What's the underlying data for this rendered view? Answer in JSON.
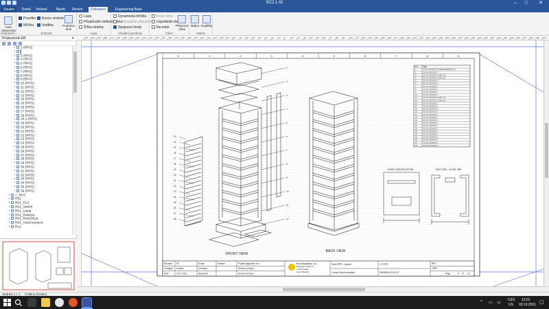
{
  "titlebar": {
    "title": "SC2.1.42"
  },
  "tabs": [
    {
      "label": "Soubor",
      "state": "file"
    },
    {
      "label": "Domů",
      "state": ""
    },
    {
      "label": "Vložení",
      "state": ""
    },
    {
      "label": "Návrh",
      "state": ""
    },
    {
      "label": "Revize",
      "state": ""
    },
    {
      "label": "Zobrazení",
      "state": "active"
    },
    {
      "label": "Engineering Base",
      "state": ""
    }
  ],
  "ribbon": {
    "groups": {
      "zobrazeni": "Zobrazení",
      "zobrazit": "Zobrazit",
      "lupa": "Lupa",
      "pomucky": "Vizuální pomůcky",
      "okno": "Okno",
      "makra": "Makra"
    },
    "btn_celaobrazovka": "Celá obrazovka",
    "chk_pravitko": "Pravítko",
    "chk_mrizka": "Mřížka",
    "chk_konce": "Konce stránek",
    "chk_voditka": "Vodítka",
    "btn_podokna": "Podokna úloh",
    "btn_lupa": "Lupa",
    "btn_prizpusobit": "Přizpůsobit velikosti okna",
    "btn_sirka": "Šířka stránky",
    "chk_dynmrizka": "Dynamická mřížka",
    "chk_autopripojeni": "Automatické připojení",
    "chk_spojovaci": "Spojovací body",
    "btn_nove_okno": "Nové okno",
    "btn_usporadat": "Uspořádat vše",
    "btn_kaskadou": "Na sebe",
    "btn_prepnout": "Přepnout okna",
    "btn_makra": "Makra",
    "btn_doplnky": "Doplňky"
  },
  "leftpanel": {
    "title": "Průzkumník EB",
    "tree": [
      {
        "label": "1 (RPS)",
        "sel": false,
        "indent": 1
      },
      {
        "label": "",
        "sel": true,
        "indent": 1
      },
      {
        "label": "3 (RPS)",
        "sel": false,
        "indent": 1
      },
      {
        "label": "4 (RPS)",
        "sel": false,
        "indent": 1
      },
      {
        "label": "5 (RPS)",
        "sel": false,
        "indent": 1
      },
      {
        "label": "6 (RPS)",
        "sel": false,
        "indent": 1
      },
      {
        "label": "7 (RPS)",
        "sel": false,
        "indent": 1
      },
      {
        "label": "8 (RPS)",
        "sel": false,
        "indent": 1
      },
      {
        "label": "9 (RPS)",
        "sel": false,
        "indent": 1
      },
      {
        "label": "10 (RPS)",
        "sel": false,
        "indent": 1
      },
      {
        "label": "11 (RPS)",
        "sel": false,
        "indent": 1
      },
      {
        "label": "12 (RPS)",
        "sel": false,
        "indent": 1
      },
      {
        "label": "13 (RPS)",
        "sel": false,
        "indent": 1
      },
      {
        "label": "14 (RPS)",
        "sel": false,
        "indent": 1
      },
      {
        "label": "15 (RPS)",
        "sel": false,
        "indent": 1
      },
      {
        "label": "16 (RPS)",
        "sel": false,
        "indent": 1
      },
      {
        "label": "17 (RPS)",
        "sel": false,
        "indent": 1
      },
      {
        "label": "18 (RPS)",
        "sel": false,
        "indent": 1
      },
      {
        "label": "18.1 (RPS)",
        "sel": false,
        "indent": 1
      },
      {
        "label": "19 (RPS)",
        "sel": false,
        "indent": 1
      },
      {
        "label": "20 (RPS)",
        "sel": false,
        "indent": 1
      },
      {
        "label": "21 (RPS)",
        "sel": false,
        "indent": 1
      },
      {
        "label": "22 (RPS)",
        "sel": false,
        "indent": 1
      },
      {
        "label": "23 (RPS)",
        "sel": false,
        "indent": 1
      },
      {
        "label": "24 (RPS)",
        "sel": false,
        "indent": 1
      },
      {
        "label": "25 (RPS)",
        "sel": false,
        "indent": 1
      },
      {
        "label": "26 (RPS)",
        "sel": false,
        "indent": 1
      },
      {
        "label": "27 (RPS)",
        "sel": false,
        "indent": 1
      },
      {
        "label": "28 (RPS)",
        "sel": false,
        "indent": 1
      },
      {
        "label": "29 (RPS)",
        "sel": false,
        "indent": 1
      },
      {
        "label": "30 (RPS)",
        "sel": false,
        "indent": 1
      },
      {
        "label": "31 (RPS)",
        "sel": false,
        "indent": 1
      },
      {
        "label": "32 (RPS)",
        "sel": false,
        "indent": 1
      },
      {
        "label": "33 (RPS)",
        "sel": false,
        "indent": 1
      },
      {
        "label": "34 (RPS)",
        "sel": false,
        "indent": 1
      },
      {
        "label": "35 (RPS)",
        "sel": false,
        "indent": 1
      },
      {
        "label": "36 (RPS)",
        "sel": false,
        "indent": 1
      },
      {
        "label": "+_RCC",
        "sel": false,
        "indent": 0
      },
      {
        "label": "R01",
        "sel": false,
        "indent": 0
      },
      {
        "label": "R01_PLC",
        "sel": false,
        "indent": 0
      },
      {
        "label": "R01_Switch",
        "sel": false,
        "indent": 0
      },
      {
        "label": "R01_Lamp",
        "sel": false,
        "indent": 0
      },
      {
        "label": "R01_Rulesys",
        "sel": false,
        "indent": 0
      },
      {
        "label": "R01_RuleSrDut",
        "sel": false,
        "indent": 0
      },
      {
        "label": "R01_AutoCounters",
        "sel": false,
        "indent": 0
      },
      {
        "label": "RLs",
        "sel": false,
        "indent": 0
      }
    ]
  },
  "ruler": {
    "ticks": [
      "310",
      "300",
      "290",
      "280",
      "270",
      "260",
      "250",
      "240",
      "230",
      "220",
      "210",
      "200",
      "190",
      "180",
      "170",
      "160",
      "150",
      "140",
      "130",
      "120",
      "110",
      "100",
      "90",
      "80",
      "70",
      "60",
      "50",
      "40",
      "30",
      "20",
      "10",
      "0",
      "10",
      "20",
      "30",
      "40",
      "50",
      "60",
      "70",
      "80",
      "90",
      "100",
      "110",
      "120",
      "130",
      "140",
      "150",
      "160",
      "170",
      "180",
      "190",
      "200",
      "210",
      "220",
      "230",
      "240",
      "250",
      "260",
      "270",
      "280",
      "290",
      "300",
      "310",
      "320",
      "330",
      "340",
      "350",
      "360",
      "370",
      "380",
      "390",
      "400"
    ]
  },
  "drawing": {
    "border_cols": [
      "0",
      "1",
      "2",
      "3",
      "4",
      "5",
      "6",
      "7",
      "8",
      "9"
    ],
    "front_view": "FRONT VIEW",
    "back_view": "BACK VIEW",
    "roof_modification": "ROOF MODIFICATION",
    "section_level": "SECTION - LEVEL 380",
    "callouts_left": [
      "13",
      "14",
      "15",
      "16",
      "17",
      "18",
      "19",
      "20",
      "21",
      "22",
      "23",
      "24",
      "25",
      "26",
      "27",
      "28"
    ],
    "callouts_right": [
      "1",
      "2",
      "3",
      "4",
      "5",
      "6",
      "7",
      "8",
      "9",
      "10",
      "11",
      "12"
    ],
    "parts_table": {
      "headers": [
        "Pos.",
        "Type"
      ],
      "rows": [
        [
          "1",
          "XX.XX.XXXXXX.X (1000x1000x800 mm)"
        ],
        [
          "2",
          "XX.XX.XXXXXX.X"
        ],
        [
          "3",
          "XX.XX.XXXXXX.X (150 mm)"
        ],
        [
          "4",
          "XX.XX.XXXXXX.X (100 mm)"
        ],
        [
          "5",
          "XX.XX.XXXXXX.X"
        ],
        [
          "6",
          "XX.XX.XXXXXX.X"
        ],
        [
          "7",
          "XX.XX.XXXXXX.X"
        ],
        [
          "8",
          "XX.XX.XXXXXX.X"
        ],
        [
          "9",
          "XX.XX.XXXXXX.X"
        ],
        [
          "10",
          "XX.XX.XXXXXX.X"
        ],
        [
          "11",
          "XX.XX.XXXXXX.X (100 mm)"
        ],
        [
          "12",
          "XX.XX.XXXXXX.X (150 mm)"
        ],
        [
          "13",
          "XX.XX.XXXXXX.X"
        ],
        [
          "14",
          "XX.XX.XXXXXX.X"
        ],
        [
          "15",
          "XX.XX.XXXXXX.X"
        ],
        [
          "16",
          "XX.XX.XXXXXX.X"
        ],
        [
          "17",
          "XX.XX.XXXXXX.X"
        ],
        [
          "18",
          "XX.XX.XXXXXX.X"
        ],
        [
          "19",
          "XX.XX.XXXXXX.X"
        ],
        [
          "20",
          "XX.XX.XXXXXX.X"
        ],
        [
          "21",
          "XX.XX.XXXXXX.X"
        ],
        [
          "22",
          "XX.XX.XXXXXX.X"
        ],
        [
          "23",
          "XX.XX.XXXXXX.X"
        ],
        [
          "24",
          "XX.XX.XXXXXX.X"
        ],
        [
          "25",
          "XX.XX.XXXXXX.X"
        ],
        [
          "26",
          "XX.XX.XXXXXX.X"
        ],
        [
          "27",
          "XX.XX.XXXXXX.X"
        ],
        [
          "28",
          "XX.XX.XXXXXX.X"
        ]
      ]
    },
    "titleblock": {
      "revision_label": "Revision",
      "revision_val": "00",
      "changed_label": "Changed",
      "changed_val": "Kostlan",
      "date_label": "Date",
      "date_val": "12.07.2021",
      "drawn_label": "Drawn",
      "drawn_val": "Kostlan",
      "checked_label": "Checked",
      "checked_val": "",
      "approved_label": "Approved",
      "approved_val": "",
      "project_l1": "Projekt Signalizer, a.s.",
      "project_l2": "Servisní pohyon",
      "project_l3": "Servisní pohyon",
      "company_l1": "Prosa Signalizer, a.s.",
      "company_l2": "Bohuslavova 368 / 12",
      "company_l3": "712 00 Ostrava",
      "company_l4": "Czech Republic",
      "desc_l1": "Rack RPS - Layout",
      "desc_l2": "Control Rack standard",
      "docnum": "59000669-SCH-01",
      "plant": "+C RPS",
      "loc1": "RPS",
      "loc2": "+RPS",
      "page_label": "Page",
      "page_val": "2",
      "pages_of": "of",
      "pages_total": "42"
    }
  },
  "status": {
    "page": "Stránka 1 z 1",
    "lang": "Čeština (Česko)"
  },
  "taskbar": {
    "lang_top": "CES",
    "lang_bot": "US",
    "time": "12:01",
    "date": "18.10.2021"
  }
}
